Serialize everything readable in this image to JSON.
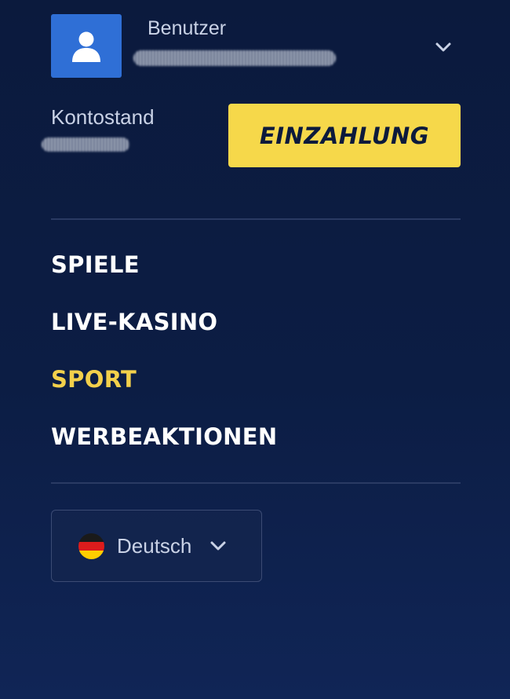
{
  "account": {
    "user_label": "Benutzer",
    "balance_label": "Kontostand",
    "deposit_label": "EINZAHLUNG"
  },
  "nav": {
    "items": [
      {
        "label": "SPIELE",
        "active": false
      },
      {
        "label": "LIVE-KASINO",
        "active": false
      },
      {
        "label": "SPORT",
        "active": true
      },
      {
        "label": "WERBEAKTIONEN",
        "active": false
      }
    ]
  },
  "language": {
    "selected": "Deutsch",
    "flag_icon": "germany-flag-icon"
  },
  "icons": {
    "avatar": "user-icon",
    "toggle": "chevron-down-icon"
  },
  "colors": {
    "background": "#0b1a3d",
    "accent_yellow": "#f6d84a",
    "active_nav": "#f3d04b",
    "avatar_blue": "#2f6fd6"
  }
}
